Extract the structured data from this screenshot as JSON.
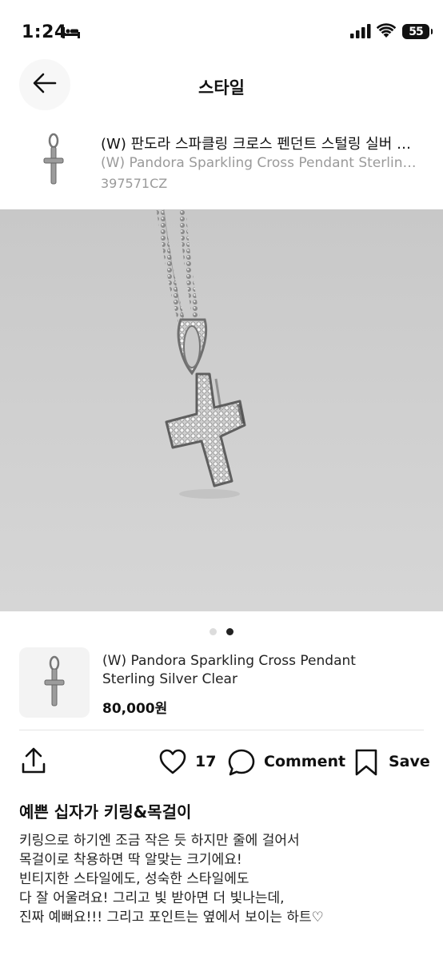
{
  "status_bar": {
    "time": "1:24",
    "battery": "55"
  },
  "nav": {
    "title": "스타일"
  },
  "product_header": {
    "title_ko": "(W) 판도라 스파클링 크로스 펜던트 스털링 실버 클리어",
    "title_en": "(W) Pandora Sparkling Cross Pendant Sterling Silver Clear",
    "code": "397571CZ"
  },
  "gallery": {
    "total": 2,
    "active_index": 1
  },
  "product_card": {
    "name": "(W) Pandora Sparkling Cross Pendant Sterling Silver Clear",
    "price": "80,000원"
  },
  "actions": {
    "like_count": "17",
    "comment_label": "Comment",
    "save_label": "Save"
  },
  "post": {
    "title": "예쁜 십자가 키링&목걸이",
    "lines": [
      "키링으로 하기엔 조금 작은 듯 하지만 줄에 걸어서",
      "목걸이로 착용하면 딱 알맞는 크기에요!",
      "빈티지한 스타일에도, 성숙한 스타일에도",
      "다 잘 어울려요! 그리고 빛 받아면 더 빛나는데,",
      "진짜 예뻐요!!! 그리고 포인트는 옆에서 보이는 하트♡"
    ]
  },
  "colors": {
    "text": "#111111",
    "muted": "#9a9a9a",
    "photo_bg": "#cfcfcf"
  }
}
